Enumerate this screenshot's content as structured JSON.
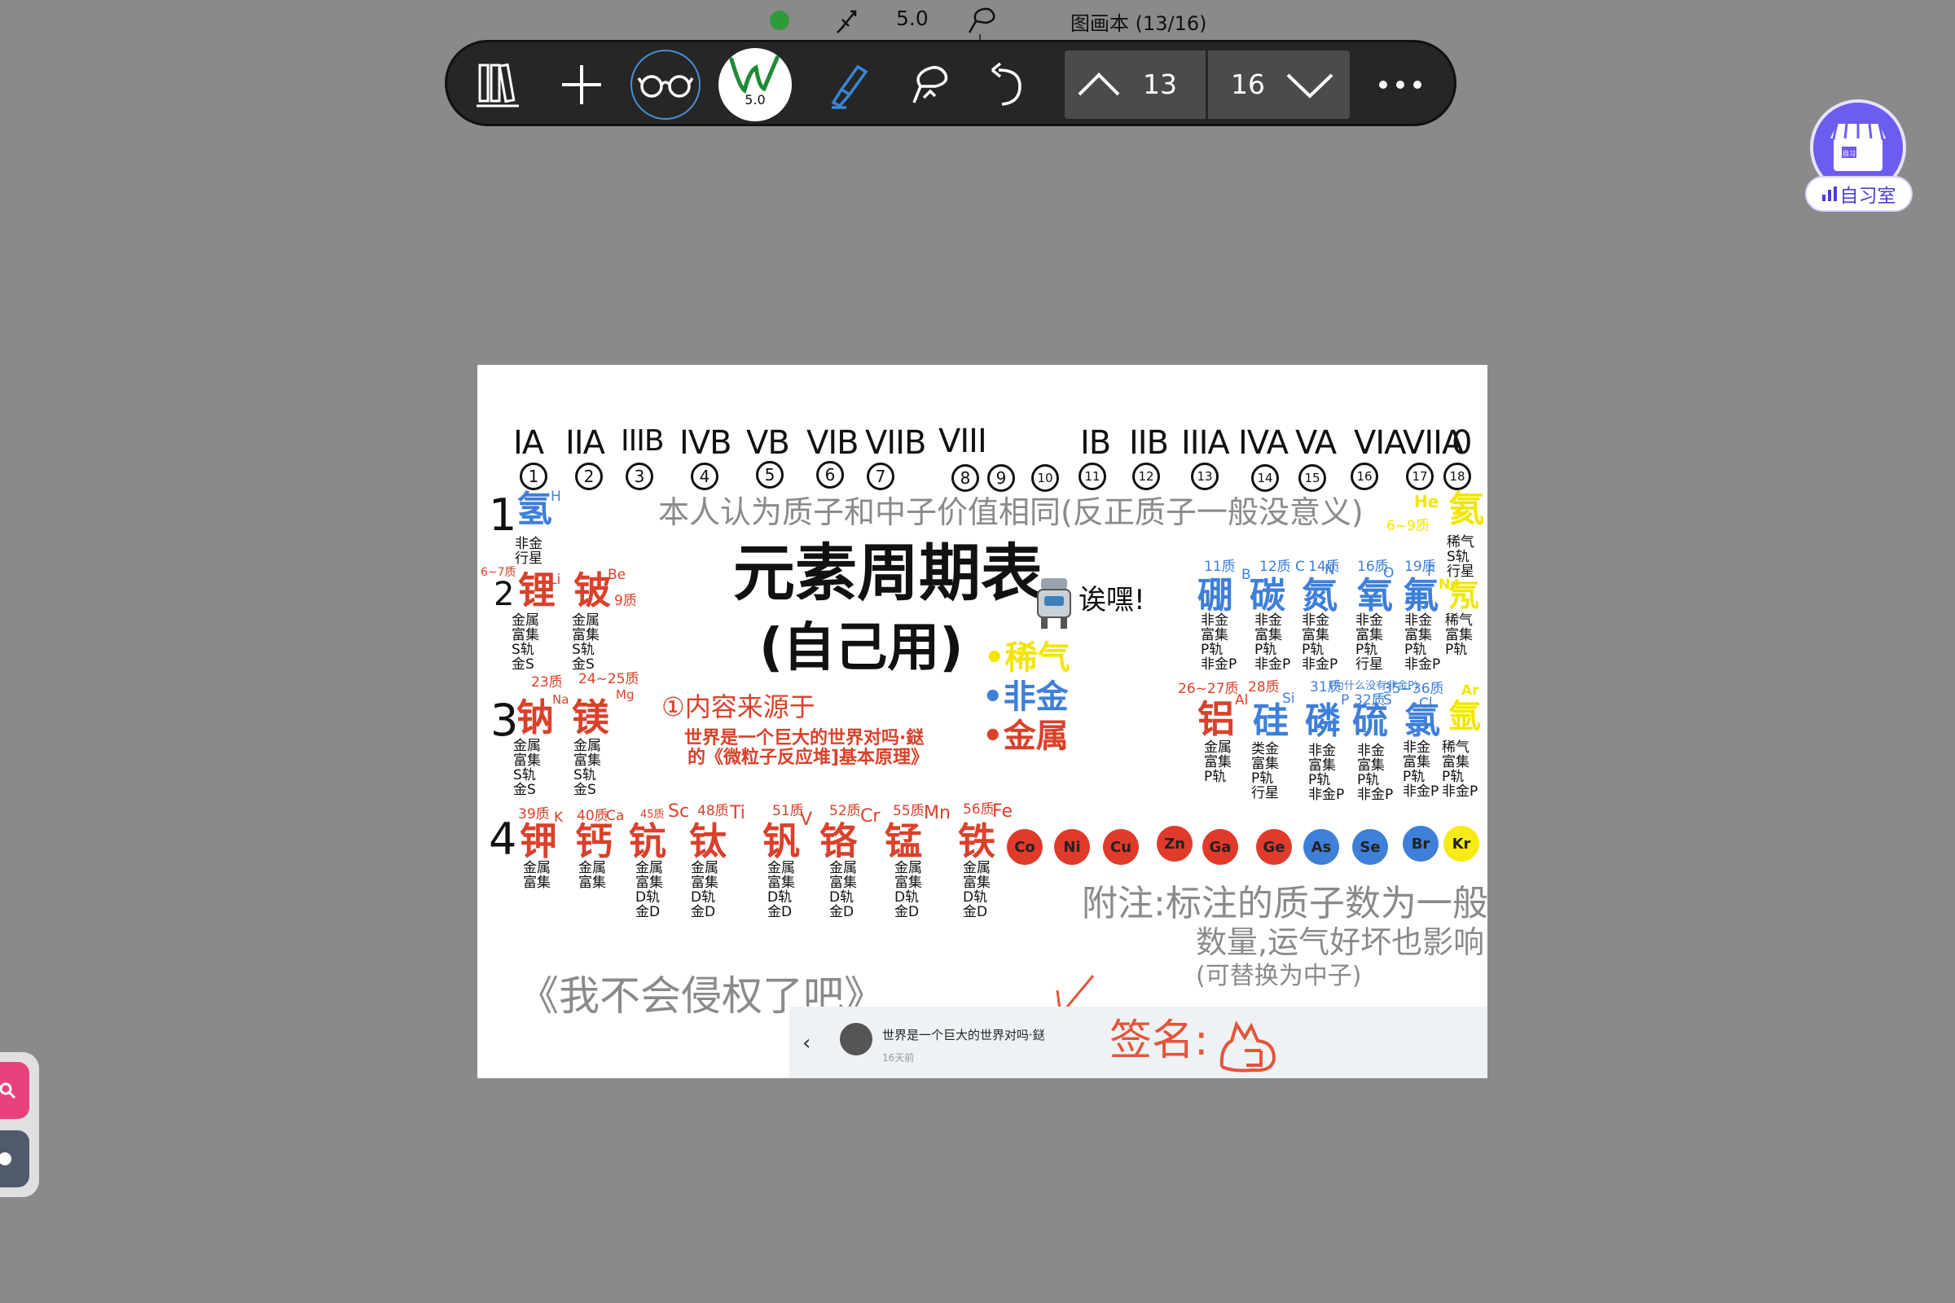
{
  "status_bar": {
    "brush_size": "5.0",
    "notebook_title": "图画本 (13/16)"
  },
  "toolbar": {
    "pen_size": "5.0",
    "current_page": "13",
    "total_pages": "16",
    "icons": [
      "library-icon",
      "add-icon",
      "reading-glasses-icon",
      "pen-icon",
      "highlighter-icon",
      "lasso-icon",
      "undo-icon",
      "page-up-icon",
      "page-down-icon",
      "more-icon"
    ]
  },
  "study_room": {
    "label": "自习室",
    "badge": "自习"
  },
  "canvas": {
    "group_headers": [
      "IA",
      "IIA",
      "IIIB",
      "IVB",
      "VB",
      "VIB",
      "VIIB",
      "VIII",
      "IB",
      "IIB",
      "IIIA",
      "IVA",
      "VA",
      "VIA",
      "VIIA",
      "0"
    ],
    "group_numbers": [
      "1",
      "2",
      "3",
      "4",
      "5",
      "6",
      "7",
      "8",
      "9",
      "10",
      "11",
      "12",
      "13",
      "14",
      "15",
      "16",
      "17",
      "18"
    ],
    "periods": [
      "1",
      "2",
      "3",
      "4"
    ],
    "proton_note": "本人认为质子和中子价值相同(反正质子一般没意义)",
    "title": "元素周期表",
    "subtitle": "(自己用)",
    "exclaim": "诶嘿!",
    "legend": {
      "noble_gas": "•稀气",
      "nonmetal": "•非金",
      "metal": "•金属"
    },
    "source_note": {
      "heading": "①内容来源于",
      "line1": "世界是一个巨大的世界对吗·鎹",
      "line2": "的《微粒子反应堆]基本原理》"
    },
    "appendix": {
      "line1": "附注:标注的质子数为一般",
      "line2": "数量,运气好坏也影响",
      "line3": "(可替换为中子)"
    },
    "disclaimer": "《我不会侵权了吧》",
    "signature_label": "签名:",
    "elements": {
      "h": {
        "name": "氢",
        "symbol": "H",
        "note": "非金\n行星"
      },
      "he": {
        "name": "氦",
        "symbol": "He",
        "tag": "6~9质",
        "note": "稀气\nS轨\n行星"
      },
      "li": {
        "name": "锂",
        "symbol": "Li",
        "tag": "6~7质",
        "note": "金属\n富集\nS轨\n金S"
      },
      "be": {
        "name": "铍",
        "symbol": "Be",
        "tag": "9质",
        "note": "金属\n富集\nS轨\n金S"
      },
      "b": {
        "name": "硼",
        "symbol": "B",
        "tag": "11质",
        "note": "非金\n富集\nP轨\n非金P"
      },
      "c": {
        "name": "碳",
        "symbol": "C",
        "tag": "12质",
        "note": "非金\n富集\nP轨\n非金P"
      },
      "n": {
        "name": "氮",
        "symbol": "N",
        "tag": "14质",
        "note": "非金\n富集\nP轨\n非金P"
      },
      "o": {
        "name": "氧",
        "symbol": "O",
        "tag": "16质",
        "note": "非金\n富集\nP轨\n行星"
      },
      "f": {
        "name": "氟",
        "symbol": "F",
        "tag": "19质",
        "note": "非金\n富集\nP轨\n非金P"
      },
      "ne": {
        "name": "氖",
        "symbol": "Ne",
        "note": "稀气\n富集\nP轨"
      },
      "na": {
        "name": "钠",
        "symbol": "Na",
        "tag": "23质",
        "note": "金属\n富集\nS轨\n金S"
      },
      "mg": {
        "name": "镁",
        "symbol": "Mg",
        "tag": "24~25质",
        "note": "金属\n富集\nS轨\n金S"
      },
      "al": {
        "name": "铝",
        "symbol": "Al",
        "tag": "26~27质",
        "note": "金属\n富集\nP轨"
      },
      "si": {
        "name": "硅",
        "symbol": "Si",
        "tag": "28质",
        "note": "类金\n富集\nP轨\n行星"
      },
      "p": {
        "name": "磷",
        "symbol": "P",
        "tag": "31质",
        "note": "非金\n富集\nP轨\n非金P"
      },
      "s": {
        "name": "硫",
        "symbol": "S",
        "tag": "32质",
        "note": "非金\n富集\nP轨\n非金P"
      },
      "s_extra": "(为什么没有非金P)",
      "cl": {
        "name": "氯",
        "symbol": "Cl",
        "tag": "35~36质",
        "note": "非金\n富集\nP轨\n非金P"
      },
      "ar": {
        "name": "氩",
        "symbol": "Ar",
        "note": "稀气\n富集\nP轨\n非金P"
      },
      "k": {
        "name": "钾",
        "symbol": "K",
        "tag": "39质",
        "note": "金属\n富集"
      },
      "ca": {
        "name": "钙",
        "symbol": "Ca",
        "tag": "40质",
        "note": "金属\n富集"
      },
      "sc": {
        "name": "钪",
        "symbol": "Sc",
        "tag": "45质",
        "note": "金属\n富集\nD轨\n金D"
      },
      "ti": {
        "name": "钛",
        "symbol": "Ti",
        "tag": "48质",
        "note": "金属\n富集\nD轨\n金D"
      },
      "v": {
        "name": "钒",
        "symbol": "V",
        "tag": "51质",
        "note": "金属\n富集\nD轨\n金D"
      },
      "cr": {
        "name": "铬",
        "symbol": "Cr",
        "tag": "52质",
        "note": "金属\n富集\nD轨\n金D"
      },
      "mn": {
        "name": "锰",
        "symbol": "Mn",
        "tag": "55质",
        "note": "金属\n富集\nD轨\n金D"
      },
      "fe": {
        "name": "铁",
        "symbol": "Fe",
        "tag": "56质",
        "note": "金属\n富集\nD轨\n金D"
      }
    },
    "balls": [
      {
        "label": "Co",
        "color": "#e03a2a"
      },
      {
        "label": "Ni",
        "color": "#e03a2a"
      },
      {
        "label": "Cu",
        "color": "#e03a2a"
      },
      {
        "label": "Zn",
        "color": "#e03a2a"
      },
      {
        "label": "Ga",
        "color": "#e03a2a"
      },
      {
        "label": "Ge",
        "color": "#e03a2a"
      },
      {
        "label": "As",
        "color": "#3e7fd8"
      },
      {
        "label": "Se",
        "color": "#3e7fd8"
      },
      {
        "label": "Br",
        "color": "#3e7fd8"
      },
      {
        "label": "Kr",
        "color": "#f7ea16"
      }
    ]
  },
  "embedded_post": {
    "title": "世界是一个巨大的世界对吗·鎹",
    "time": "16天前"
  }
}
